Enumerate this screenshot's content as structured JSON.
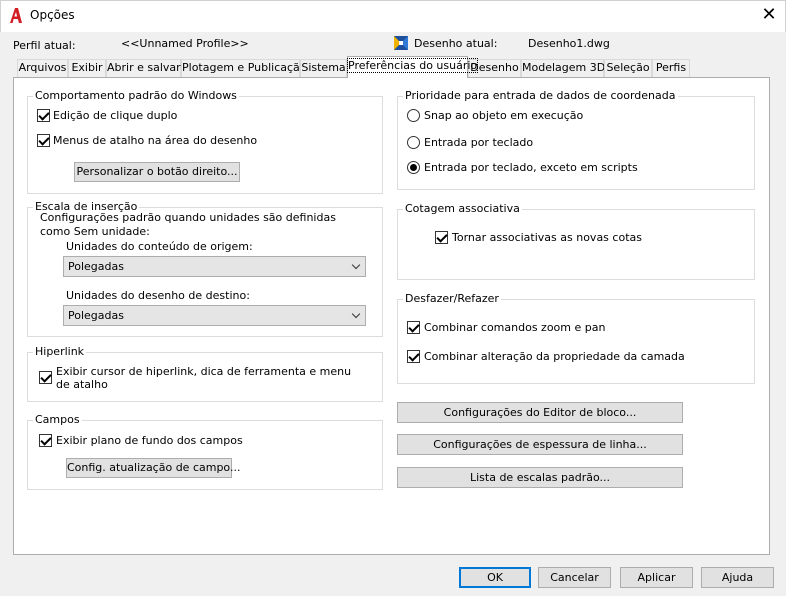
{
  "window": {
    "title": "Opções",
    "close_glyph": "✕",
    "app_icon": "autocad-a-icon"
  },
  "header": {
    "profile_label": "Perfil atual:",
    "profile_value": "<<Unnamed Profile>>",
    "drawing_label": "Desenho atual:",
    "drawing_value": "Desenho1.dwg",
    "drawing_icon": "drawing-file-icon"
  },
  "tabs": [
    "Arquivos",
    "Exibir",
    "Abrir e salvar",
    "Plotagem e Publicação",
    "Sistema",
    "Preferências do usuário",
    "Desenho",
    "Modelagem 3D",
    "Seleção",
    "Perfis"
  ],
  "active_tab": "Preferências do usuário",
  "windows_behavior": {
    "title": "Comportamento padrão do Windows",
    "double_click": {
      "label": "Edição de clique duplo",
      "checked": true
    },
    "shortcut_menus": {
      "label": "Menus de atalho na área do desenho",
      "checked": true
    },
    "right_click_button": "Personalizar o botão direito..."
  },
  "insertion_scale": {
    "title": "Escala de inserção",
    "desc_line1": "Configurações padrão quando unidades são definidas",
    "desc_line2": "como Sem unidade:",
    "source_label": "Unidades do conteúdo de origem:",
    "source_value": "Polegadas",
    "target_label": "Unidades do desenho de destino:",
    "target_value": "Polegadas"
  },
  "hyperlink": {
    "title": "Hiperlink",
    "line1": "Exibir cursor de hiperlink, dica de ferramenta e menu",
    "line2": "de atalho",
    "checked": true
  },
  "fields": {
    "title": "Campos",
    "background": {
      "label": "Exibir plano de fundo dos campos",
      "checked": true
    },
    "update_button": "Config. atualização de campo..."
  },
  "coord_priority": {
    "title": "Prioridade para entrada de dados de coordenada",
    "options": [
      "Snap ao objeto em execução",
      "Entrada por teclado",
      "Entrada por teclado, exceto em scripts"
    ],
    "selected_index": 2
  },
  "assoc_dim": {
    "title": "Cotagem associativa",
    "make_assoc": {
      "label": "Tornar associativas as novas cotas",
      "checked": true
    }
  },
  "undo_redo": {
    "title": "Desfazer/Refazer",
    "combine_zoom": {
      "label": "Combinar comandos zoom e pan",
      "checked": true
    },
    "combine_layer": {
      "label": "Combinar alteração da propriedade da camada",
      "checked": true
    }
  },
  "right_buttons": {
    "block_editor": "Configurações do Editor de bloco...",
    "lineweight": "Configurações de espessura de linha...",
    "scale_list": "Lista de escalas padrão..."
  },
  "footer": {
    "ok": "OK",
    "cancel": "Cancelar",
    "apply": "Aplicar",
    "help": "Ajuda"
  }
}
